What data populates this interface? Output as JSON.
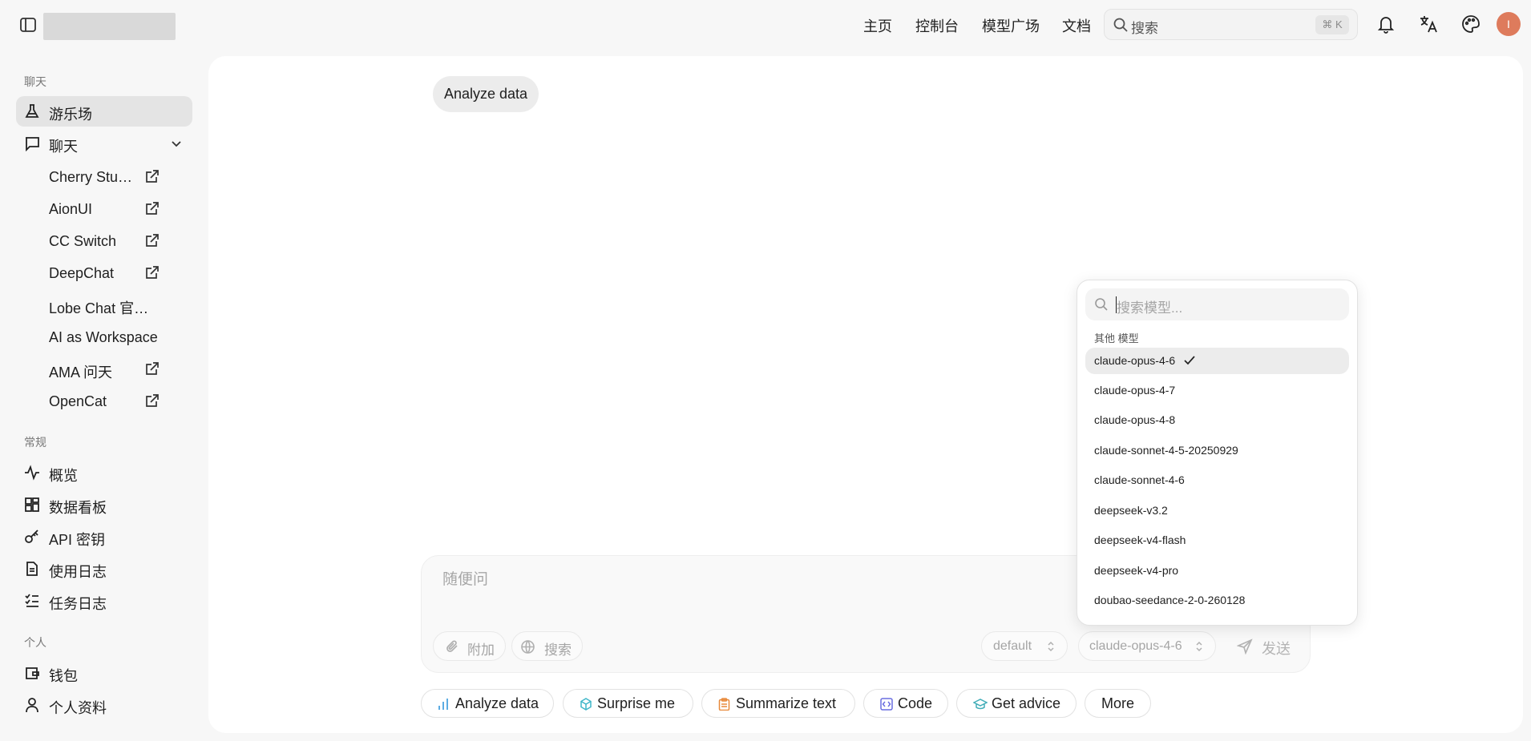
{
  "header": {
    "nav": [
      "主页",
      "控制台",
      "模型广场",
      "文档"
    ],
    "search_placeholder": "搜索",
    "search_shortcut": "⌘ K",
    "avatar_initial": "I"
  },
  "sidebar": {
    "section_chat": "聊天",
    "playground": "游乐场",
    "chat": "聊天",
    "chat_apps": [
      "Cherry Stu…",
      "AionUI",
      "CC Switch",
      "DeepChat",
      "Lobe Chat 官方…",
      "AI as Workspace",
      "AMA 问天",
      "OpenCat"
    ],
    "section_general": "常规",
    "general": [
      "概览",
      "数据看板",
      "API 密钥",
      "使用日志",
      "任务日志"
    ],
    "section_personal": "个人",
    "personal": [
      "钱包",
      "个人资料"
    ]
  },
  "conversation": {
    "user_message": "Analyze data"
  },
  "composer": {
    "placeholder": "随便问",
    "attach": "附加",
    "search": "搜索",
    "mode": "default",
    "model": "claude-opus-4-6",
    "send": "发送"
  },
  "suggestions": [
    {
      "label": "Analyze data",
      "icon": "bar-chart-icon",
      "color": "#4aa3e0"
    },
    {
      "label": "Surprise me",
      "icon": "cube-icon",
      "color": "#3fb7c9"
    },
    {
      "label": "Summarize text",
      "icon": "clipboard-icon",
      "color": "#e88a3c"
    },
    {
      "label": "Code",
      "icon": "code-icon",
      "color": "#6a6ee0"
    },
    {
      "label": "Get advice",
      "icon": "graduation-cap-icon",
      "color": "#43aeb8"
    },
    {
      "label": "More",
      "icon": "",
      "color": ""
    }
  ],
  "model_dropdown": {
    "search_placeholder": "搜索模型...",
    "group_label": "其他 模型",
    "selected": "claude-opus-4-6",
    "models": [
      "claude-opus-4-6",
      "claude-opus-4-7",
      "claude-opus-4-8",
      "claude-sonnet-4-5-20250929",
      "claude-sonnet-4-6",
      "deepseek-v3.2",
      "deepseek-v4-flash",
      "deepseek-v4-pro",
      "doubao-seedance-2-0-260128"
    ]
  },
  "colors": {
    "accent_avatar": "#de7b5c",
    "active_item_bg": "#e4e4e4",
    "page_bg": "#f7f7f7"
  }
}
